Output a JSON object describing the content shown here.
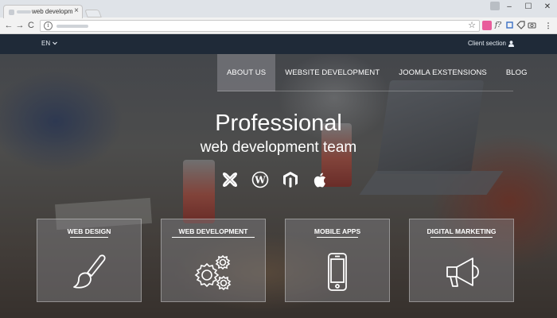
{
  "browser": {
    "tab_title": "web developm",
    "tab_close": "×",
    "window_buttons": [
      "–",
      "☐",
      "✕"
    ],
    "nav_back": "←",
    "nav_forward": "→",
    "nav_reload": "C",
    "omnibox_info": "i",
    "omnibox_star": "☆"
  },
  "site": {
    "language": "EN",
    "client_section": "Client section",
    "nav": [
      {
        "label": "ABOUT US",
        "active": true
      },
      {
        "label": "WEBSITE DEVELOPMENT",
        "active": false
      },
      {
        "label": "JOOMLA EXSTENSIONS",
        "active": false
      },
      {
        "label": "BLOG",
        "active": false
      }
    ],
    "hero_title": "Professional",
    "hero_subtitle": "web development team",
    "cms_icons": [
      "joomla-icon",
      "wordpress-icon",
      "magento-icon",
      "apple-icon"
    ],
    "cards": [
      {
        "title": "WEB DESIGN",
        "icon": "brush-icon"
      },
      {
        "title": "WEB DEVELOPMENT",
        "icon": "gears-icon"
      },
      {
        "title": "MOBILE APPS",
        "icon": "smartphone-icon"
      },
      {
        "title": "DIGITAL MARKETING",
        "icon": "megaphone-icon"
      }
    ],
    "colors": {
      "topbar": "#1f2a38",
      "active_nav": "#78787d",
      "text": "#ffffff"
    }
  }
}
